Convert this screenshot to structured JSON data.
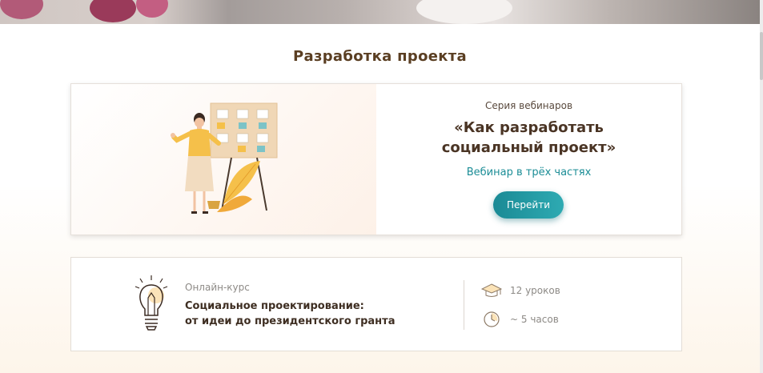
{
  "section": {
    "title": "Разработка проекта"
  },
  "webinar": {
    "series_label": "Серия вебинаров",
    "title_line1": "«Как разработать",
    "title_line2": "социальный проект»",
    "subtitle": "Вебинар в трёх частях",
    "button_label": "Перейти"
  },
  "course": {
    "type_label": "Онлайн-курс",
    "title_line1": "Социальное проектирование:",
    "title_line2": "от идеи до президентского гранта",
    "lessons": "12 уроков",
    "duration": "~ 5 часов"
  },
  "colors": {
    "accent": "#1b8d96",
    "heading": "#5a3e22",
    "illustration_yellow": "#f5c04a"
  },
  "icons": [
    "graduation-cap-icon",
    "clock-icon",
    "lightbulb-pencil-icon"
  ]
}
